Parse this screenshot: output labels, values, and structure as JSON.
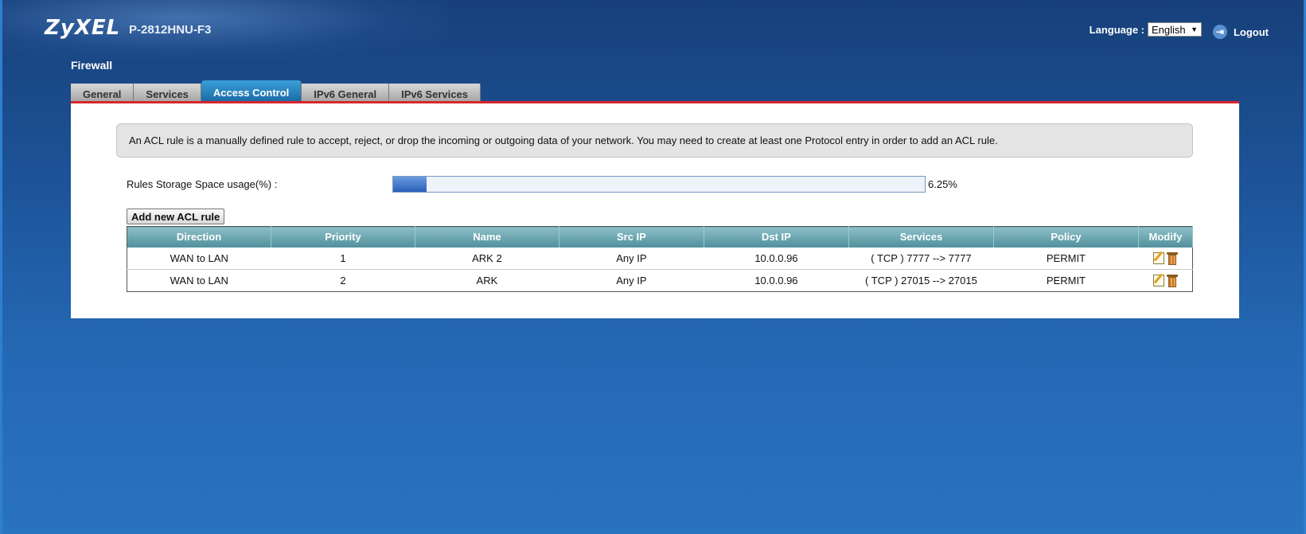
{
  "header": {
    "brand": "ZyXEL",
    "model": "P-2812HNU-F3",
    "language_label": "Language :",
    "language_value": "English",
    "logout_label": "Logout"
  },
  "page": {
    "title": "Firewall"
  },
  "tabs": [
    {
      "label": "General",
      "active": false
    },
    {
      "label": "Services",
      "active": false
    },
    {
      "label": "Access Control",
      "active": true
    },
    {
      "label": "IPv6 General",
      "active": false
    },
    {
      "label": "IPv6 Services",
      "active": false
    }
  ],
  "info": {
    "text": "An ACL rule is a manually defined rule to accept, reject, or drop the incoming or outgoing data of your network. You may need to create at least one Protocol entry in order to add an ACL rule."
  },
  "usage": {
    "label": "Rules Storage Space usage(%) :",
    "value_text": "6.25%",
    "percent": 6.25
  },
  "add_button": {
    "label": "Add new ACL rule"
  },
  "table": {
    "columns": [
      "Direction",
      "Priority",
      "Name",
      "Src IP",
      "Dst IP",
      "Services",
      "Policy",
      "Modify"
    ],
    "rows": [
      {
        "direction": "WAN to LAN",
        "priority": "1",
        "name": "ARK 2",
        "src_ip": "Any IP",
        "dst_ip": "10.0.0.96",
        "services": "( TCP ) 7777 --> 7777",
        "policy": "PERMIT"
      },
      {
        "direction": "WAN to LAN",
        "priority": "2",
        "name": "ARK",
        "src_ip": "Any IP",
        "dst_ip": "10.0.0.96",
        "services": "( TCP ) 27015 --> 27015",
        "policy": "PERMIT"
      }
    ]
  },
  "icons": {
    "logout": "logout-icon",
    "edit": "edit-icon",
    "delete": "trash-icon"
  },
  "colors": {
    "accent_red": "#d8262d",
    "active_tab": "#1f7bbf",
    "table_header": "#6aa6b1"
  }
}
